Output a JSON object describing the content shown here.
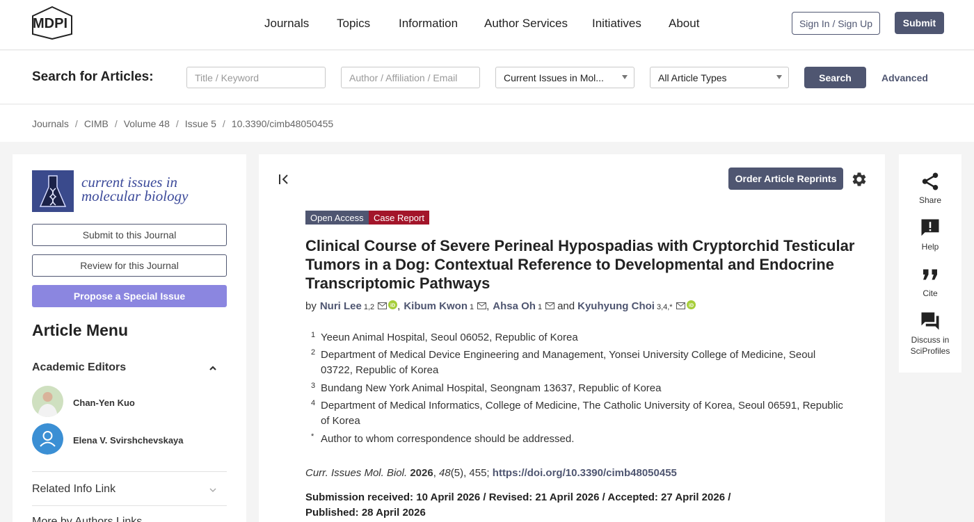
{
  "nav": {
    "logo_text": "MDPI",
    "items": [
      "Journals",
      "Topics",
      "Information",
      "Author Services",
      "Initiatives",
      "About"
    ],
    "signin_label": "Sign In / Sign Up",
    "submit_label": "Submit"
  },
  "search": {
    "label": "Search for Articles:",
    "title_placeholder": "Title / Keyword",
    "author_placeholder": "Author / Affiliation / Email",
    "journal_select": "Current Issues in Mol...",
    "type_select": "All Article Types",
    "search_button": "Search",
    "advanced_link": "Advanced"
  },
  "breadcrumb": [
    "Journals",
    "CIMB",
    "Volume 48",
    "Issue 5",
    "10.3390/cimb48050455"
  ],
  "sidebar": {
    "journal_name_line1": "current issues in",
    "journal_name_line2": "molecular biology",
    "submit_journal": "Submit to this Journal",
    "review_journal": "Review for this Journal",
    "propose_special": "Propose a Special Issue",
    "article_menu": "Article Menu",
    "academic_editors": "Academic Editors",
    "editors": [
      "Chan-Yen Kuo",
      "Elena V. Svirshchevskaya"
    ],
    "related_info": "Related Info Link",
    "more_by_authors": "More by Authors Links"
  },
  "article": {
    "reprints_button": "Order Article Reprints",
    "badge_open": "Open Access",
    "badge_type": "Case Report",
    "title": "Clinical Course of Severe Perineal Hypospadias with Cryptorchid Testicular Tumors in a Dog: Contextual Reference to Developmental and Endocrine Transcriptomic Pathways",
    "by": "by",
    "authors": [
      {
        "name": "Nuri Lee",
        "sup": "1,2"
      },
      {
        "name": "Kibum Kwon",
        "sup": "1"
      },
      {
        "name": "Ahsa Oh",
        "sup": "1"
      },
      {
        "name": "Kyuhyung Choi",
        "sup": "3,4,*"
      }
    ],
    "and": "and",
    "affiliations": [
      {
        "num": "1",
        "text": "Yeeun Animal Hospital, Seoul 06052, Republic of Korea"
      },
      {
        "num": "2",
        "text": "Department of Medical Device Engineering and Management, Yonsei University College of Medicine, Seoul 03722, Republic of Korea"
      },
      {
        "num": "3",
        "text": "Bundang New York Animal Hospital, Seongnam 13637, Republic of Korea"
      },
      {
        "num": "4",
        "text": "Department of Medical Informatics, College of Medicine, The Catholic University of Korea, Seoul 06591, Republic of Korea"
      },
      {
        "num": "*",
        "text": "Author to whom correspondence should be addressed."
      }
    ],
    "citation_journal": "Curr. Issues Mol. Biol.",
    "citation_year": "2026",
    "citation_volume": "48",
    "citation_rest": "(5), 455;",
    "doi": "https://doi.org/10.3390/cimb48050455",
    "dates": "Submission received: 10 April 2026 / Revised: 21 April 2026 / Accepted: 27 April 2026 / Published: 28 April 2026"
  },
  "right_sidebar": {
    "share": "Share",
    "help": "Help",
    "cite": "Cite",
    "discuss_line1": "Discuss in",
    "discuss_line2": "SciProfiles"
  },
  "colors": {
    "brand": "#4f5671",
    "case_report": "#a3152a",
    "propose_button": "#8b86e0",
    "orcid": "#a6ce39"
  }
}
